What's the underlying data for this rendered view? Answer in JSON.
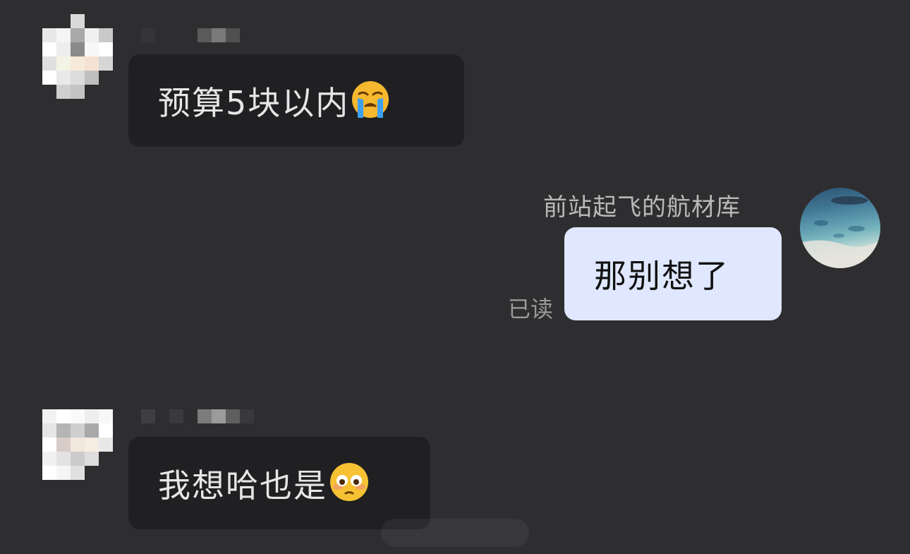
{
  "messages": [
    {
      "id": "msg1",
      "direction": "incoming",
      "text": "预算5块以内",
      "emoji": "loudly-crying-face"
    },
    {
      "id": "msg2",
      "direction": "outgoing",
      "sender_name": "前站起飞的航材库",
      "text": "那别想了",
      "status": "已读"
    },
    {
      "id": "msg3",
      "direction": "incoming",
      "text": "我想哈也是",
      "emoji": "flushed-face"
    }
  ],
  "colors": {
    "background": "#2e2e30",
    "incoming_bubble": "#202022",
    "outgoing_bubble": "#dfe8ff"
  }
}
